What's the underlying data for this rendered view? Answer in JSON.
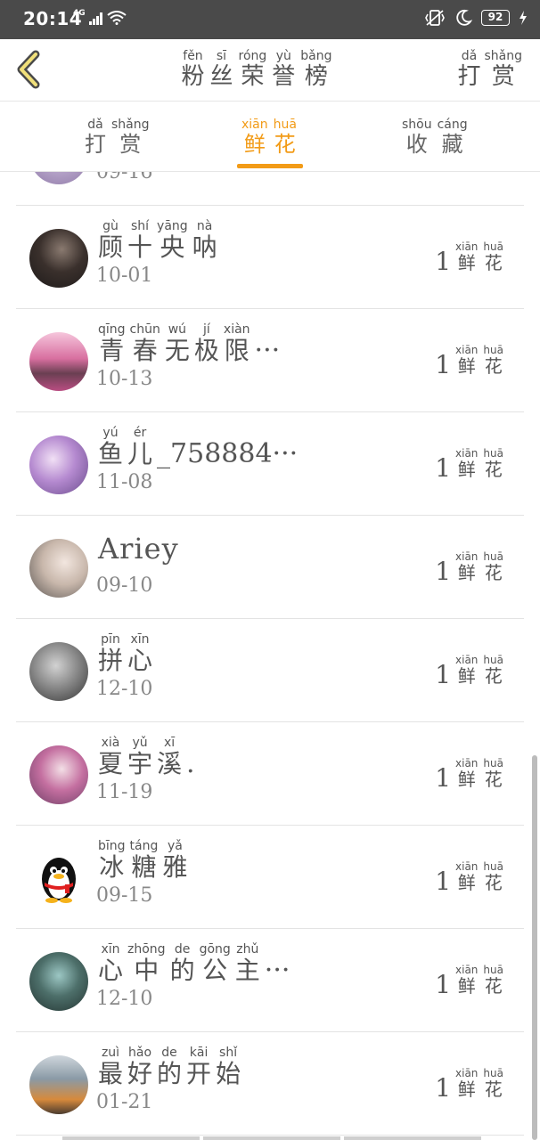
{
  "status": {
    "time": "20:14",
    "battery": "92",
    "network": "4G"
  },
  "header": {
    "back_icon": "chevron-left-icon",
    "title": [
      {
        "ch": "粉",
        "py": "fěn"
      },
      {
        "ch": "丝",
        "py": "sī"
      },
      {
        "ch": "荣",
        "py": "róng"
      },
      {
        "ch": "誉",
        "py": "yù"
      },
      {
        "ch": "榜",
        "py": "bǎng"
      }
    ],
    "right_action": [
      {
        "ch": "打",
        "py": "dǎ"
      },
      {
        "ch": "赏",
        "py": "shǎng"
      }
    ]
  },
  "tabs": [
    {
      "chars": [
        {
          "ch": "打",
          "py": "dǎ"
        },
        {
          "ch": "赏",
          "py": "shǎng"
        }
      ],
      "active": false
    },
    {
      "chars": [
        {
          "ch": "鲜",
          "py": "xiān"
        },
        {
          "ch": "花",
          "py": "huā"
        }
      ],
      "active": true
    },
    {
      "chars": [
        {
          "ch": "收",
          "py": "shōu"
        },
        {
          "ch": "藏",
          "py": "cáng"
        }
      ],
      "active": false
    }
  ],
  "colors": {
    "accent": "#f29b17",
    "text": "#555555",
    "date": "#888888"
  },
  "unit": [
    {
      "ch": "鲜",
      "py": "xiān"
    },
    {
      "ch": "花",
      "py": "huā"
    }
  ],
  "rows": [
    {
      "name": [],
      "date": "09-16",
      "count": "",
      "partial": true
    },
    {
      "name": [
        {
          "ch": "顾",
          "py": "gù"
        },
        {
          "ch": "十",
          "py": "shí"
        },
        {
          "ch": "央",
          "py": "yāng"
        },
        {
          "ch": "呐",
          "py": "nà"
        }
      ],
      "date": "10-01",
      "count": "1"
    },
    {
      "name": [
        {
          "ch": "青",
          "py": "qīng"
        },
        {
          "ch": "春",
          "py": "chūn"
        },
        {
          "ch": "无",
          "py": "wú"
        },
        {
          "ch": "极",
          "py": "jí"
        },
        {
          "ch": "限",
          "py": "xiàn"
        }
      ],
      "suffix": "···",
      "date": "10-13",
      "count": "1"
    },
    {
      "name": [
        {
          "ch": "鱼",
          "py": "yú"
        },
        {
          "ch": "儿",
          "py": "ér"
        }
      ],
      "suffix": "_758884···",
      "date": "11-08",
      "count": "1"
    },
    {
      "name": [],
      "plain": "Ariey",
      "date": "09-10",
      "count": "1"
    },
    {
      "name": [
        {
          "ch": "拼",
          "py": "pīn"
        },
        {
          "ch": "心",
          "py": "xīn"
        }
      ],
      "date": "12-10",
      "count": "1"
    },
    {
      "name": [
        {
          "ch": "夏",
          "py": "xià"
        },
        {
          "ch": "宇",
          "py": "yǔ"
        },
        {
          "ch": "溪",
          "py": "xī"
        }
      ],
      "suffix": ".",
      "date": "11-19",
      "count": "1"
    },
    {
      "name": [
        {
          "ch": "冰",
          "py": "bīng"
        },
        {
          "ch": "糖",
          "py": "táng"
        },
        {
          "ch": "雅",
          "py": "yǎ"
        }
      ],
      "date": "09-15",
      "count": "1"
    },
    {
      "name": [
        {
          "ch": "心",
          "py": "xīn"
        },
        {
          "ch": "中",
          "py": "zhōng"
        },
        {
          "ch": "的",
          "py": "de"
        },
        {
          "ch": "公",
          "py": "gōng"
        },
        {
          "ch": "主",
          "py": "zhǔ"
        }
      ],
      "suffix": "···",
      "date": "12-10",
      "count": "1"
    },
    {
      "name": [
        {
          "ch": "最",
          "py": "zuì"
        },
        {
          "ch": "好",
          "py": "hǎo"
        },
        {
          "ch": "的",
          "py": "de"
        },
        {
          "ch": "开",
          "py": "kāi"
        },
        {
          "ch": "始",
          "py": "shǐ"
        }
      ],
      "date": "01-21",
      "count": "1"
    }
  ]
}
